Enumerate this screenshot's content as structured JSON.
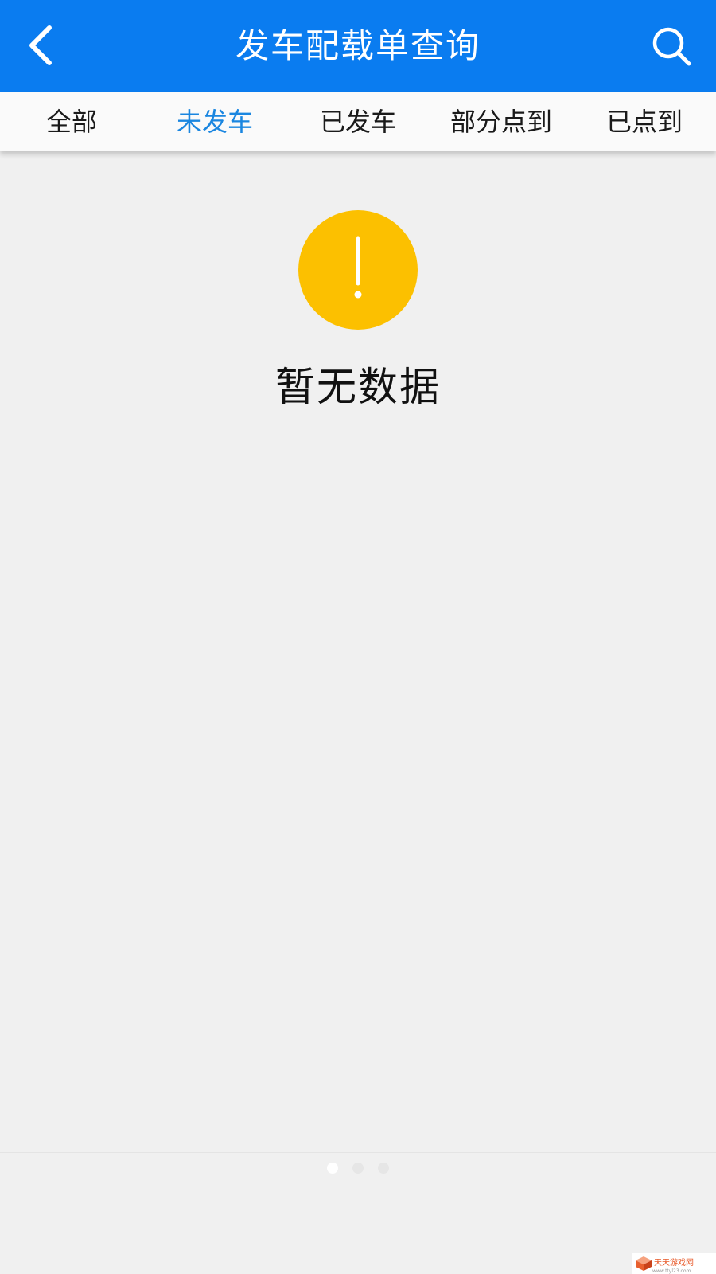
{
  "header": {
    "title": "发车配载单查询",
    "back_icon": "chevron-left-icon",
    "search_icon": "search-icon",
    "background_color": "#0a7cf0"
  },
  "tabs": {
    "active_color": "#1a86e0",
    "items": [
      {
        "label": "全部",
        "active": false
      },
      {
        "label": "未发车",
        "active": true
      },
      {
        "label": "已发车",
        "active": false
      },
      {
        "label": "部分点到",
        "active": false
      },
      {
        "label": "已点到",
        "active": false
      }
    ]
  },
  "empty_state": {
    "icon": "exclamation-icon",
    "icon_color": "#fcc000",
    "message": "暂无数据"
  },
  "pager": {
    "count": 3,
    "active_index": 0
  },
  "watermark": {
    "brand": "天天游戏网",
    "url": "www.ttyl23.com"
  }
}
